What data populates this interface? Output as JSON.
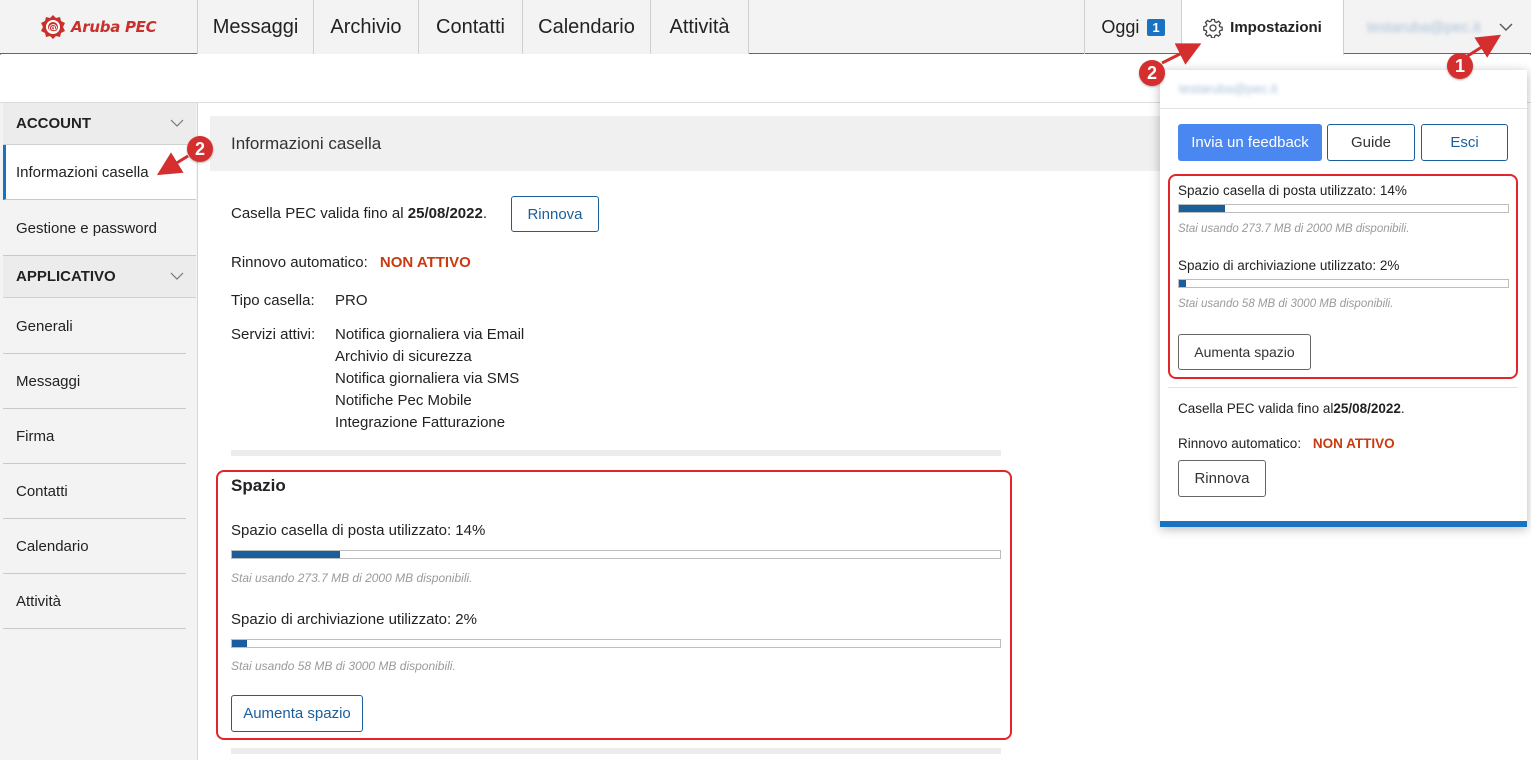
{
  "header": {
    "logo_text": "Aruba PEC",
    "tabs": [
      "Messaggi",
      "Archivio",
      "Contatti",
      "Calendario",
      "Attività"
    ],
    "today_label": "Oggi",
    "today_count": "1",
    "settings_label": "Impostazioni",
    "user_email": "testaruba@pec.it"
  },
  "sidebar": {
    "account_label": "ACCOUNT",
    "account_items": [
      "Informazioni casella",
      "Gestione e password"
    ],
    "app_label": "APPLICATIVO",
    "app_items": [
      "Generali",
      "Messaggi",
      "Firma",
      "Contatti",
      "Calendario",
      "Attività"
    ]
  },
  "main": {
    "title": "Informazioni casella",
    "validity_prefix": "Casella PEC valida fino al",
    "validity_date": "25/08/2022",
    "validity_suffix": ".",
    "renew_label": "Rinnova",
    "auto_renew_label": "Rinnovo automatico:",
    "auto_renew_value": "NON ATTIVO",
    "type_label": "Tipo casella:",
    "type_value": "PRO",
    "services_label": "Servizi attivi:",
    "services": [
      "Notifica giornaliera via Email",
      "Archivio di sicurezza",
      "Notifica giornaliera via SMS",
      "Notifiche Pec Mobile",
      "Integrazione Fatturazione"
    ],
    "space": {
      "title": "Spazio",
      "mailbox_label": "Spazio casella di posta utilizzato: 14%",
      "mailbox_fraction": 0.14,
      "mailbox_note": "Stai usando 273.7 MB di 2000 MB disponibili.",
      "archive_label": "Spazio di archiviazione utilizzato: 2%",
      "archive_fraction": 0.02,
      "archive_note": "Stai usando 58 MB di 3000 MB disponibili.",
      "increase_label": "Aumenta spazio"
    }
  },
  "dropdown": {
    "email": "testaruba@pec.it",
    "feedback_label": "Invia un feedback",
    "guide_label": "Guide",
    "logout_label": "Esci",
    "mailbox_label": "Spazio casella di posta utilizzato: 14%",
    "mailbox_fraction": 0.14,
    "mailbox_note": "Stai usando 273.7 MB di 2000 MB disponibili.",
    "archive_label": "Spazio di archiviazione utilizzato: 2%",
    "archive_fraction": 0.02,
    "archive_note": "Stai usando 58 MB di 3000 MB disponibili.",
    "increase_label": "Aumenta spazio",
    "validity_prefix": "Casella PEC valida fino al",
    "validity_date": "25/08/2022",
    "validity_suffix": ".",
    "auto_renew_label": "Rinnovo automatico:",
    "auto_renew_value": "NON ATTIVO",
    "renew_label": "Rinnova"
  },
  "annotations": {
    "callout_1": "1",
    "callout_2": "2"
  },
  "colors": {
    "accent": "#1a73c2",
    "brand_red": "#c9302c",
    "warning": "#c83b10",
    "annotation_red": "#e0262b"
  }
}
